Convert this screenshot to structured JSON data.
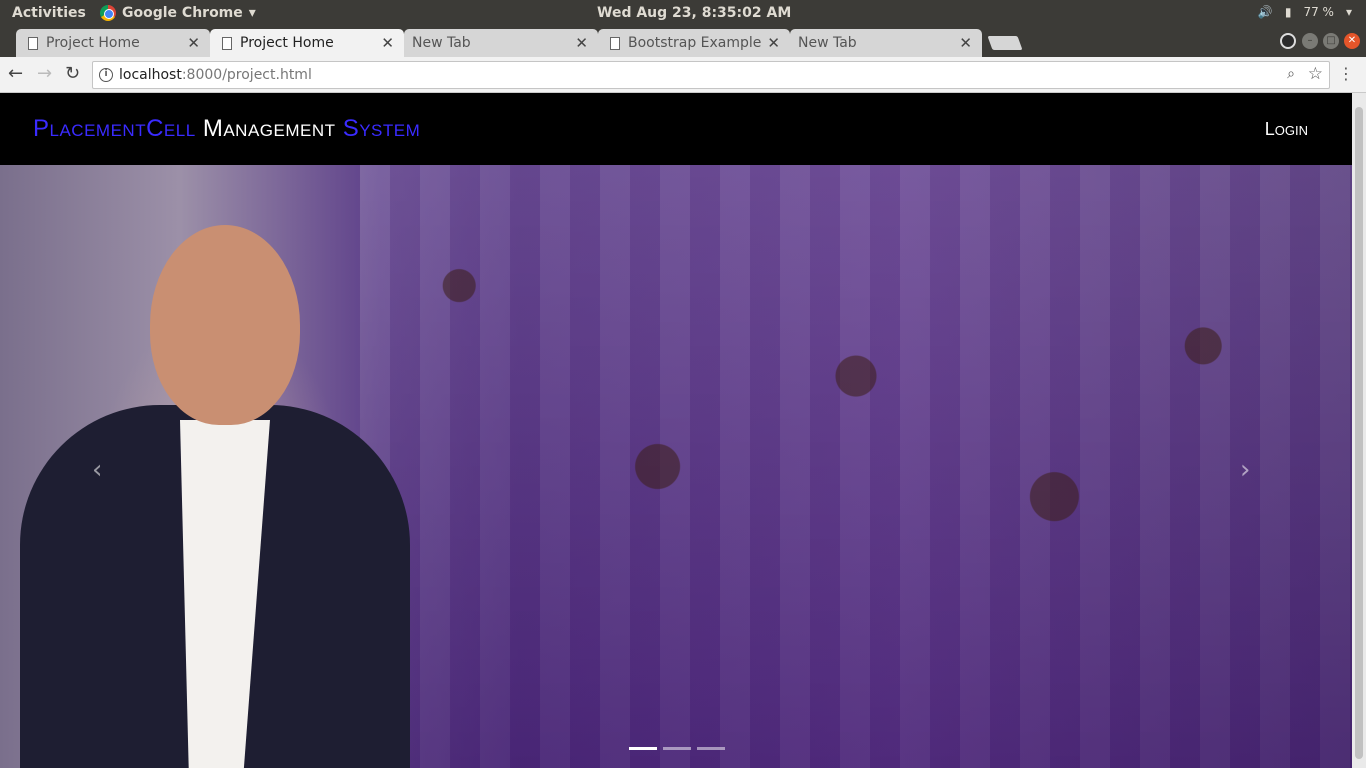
{
  "system": {
    "activities": "Activities",
    "app_name": "Google Chrome",
    "clock": "Wed Aug 23,  8:35:02 AM",
    "battery": "77 %"
  },
  "tabs": [
    {
      "label": "Project Home",
      "active": false
    },
    {
      "label": "Project Home",
      "active": true
    },
    {
      "label": "New Tab",
      "active": false
    },
    {
      "label": "Bootstrap Example",
      "active": false
    },
    {
      "label": "New Tab",
      "active": false
    }
  ],
  "address": {
    "host": "localhost",
    "path": ":8000/project.html"
  },
  "navbar": {
    "brand_part1": "PlacementCell",
    "brand_part2": "Management",
    "brand_part3": "System",
    "login": "Login"
  },
  "carousel": {
    "prev_glyph": "‹",
    "next_glyph": "›",
    "slides": 3,
    "active_slide": 1
  },
  "colors": {
    "brand_blue": "#3a2bff",
    "navbar_bg": "#000000"
  }
}
